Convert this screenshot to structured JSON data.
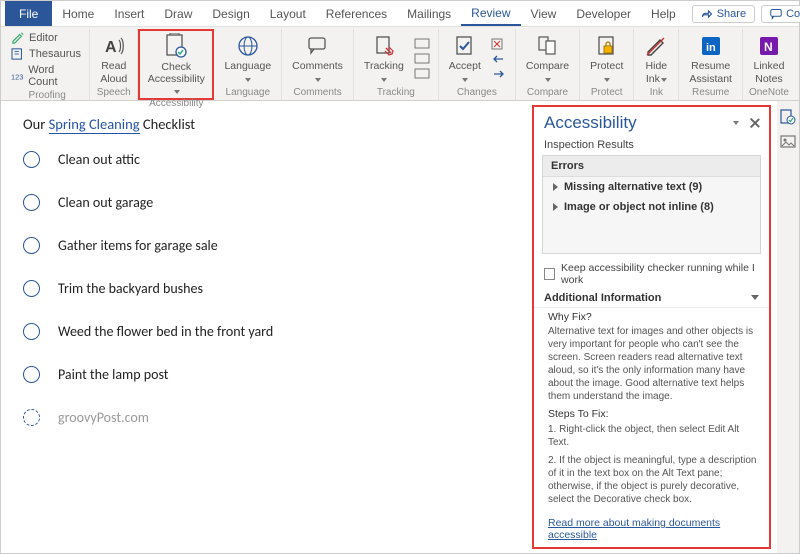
{
  "menubar": {
    "file": "File",
    "tabs": [
      "Home",
      "Insert",
      "Draw",
      "Design",
      "Layout",
      "References",
      "Mailings",
      "Review",
      "View",
      "Developer",
      "Help"
    ],
    "active_tab_index": 7,
    "share": "Share",
    "comments": "Comments"
  },
  "ribbon": {
    "proofing": {
      "items": [
        "Editor",
        "Thesaurus",
        "Word Count"
      ],
      "label": "Proofing"
    },
    "speech": {
      "button": "Read\nAloud",
      "label": "Speech"
    },
    "accessibility": {
      "button": "Check\nAccessibility",
      "label": "Accessibility"
    },
    "language": {
      "button": "Language",
      "label": "Language"
    },
    "comments": {
      "button": "Comments",
      "label": "Comments"
    },
    "tracking": {
      "button": "Tracking",
      "label": "Tracking"
    },
    "accept": {
      "button": "Accept",
      "label": "Changes"
    },
    "compare": {
      "button": "Compare",
      "label": "Compare"
    },
    "protect": {
      "button": "Protect",
      "label": "Protect"
    },
    "ink": {
      "button": "Hide\nInk",
      "label": "Ink"
    },
    "resume": {
      "button": "Resume\nAssistant",
      "label": "Resume"
    },
    "onenote": {
      "button": "Linked\nNotes",
      "label": "OneNote"
    }
  },
  "document": {
    "title_pre": "Our ",
    "title_link": "Spring Cleaning",
    "title_post": " Checklist",
    "items": [
      "Clean out attic",
      "Clean out garage",
      "Gather items for garage sale",
      "Trim the backyard bushes",
      "Weed the flower bed in the front yard",
      "Paint the lamp post"
    ],
    "watermark": "groovyPost.com"
  },
  "pane": {
    "title": "Accessibility",
    "subtitle": "Inspection Results",
    "errors_header": "Errors",
    "errors": [
      "Missing alternative text (9)",
      "Image or object not inline (8)"
    ],
    "checkbox_label": "Keep accessibility checker running while I work",
    "addinfo_header": "Additional Information",
    "why_fix_h": "Why Fix?",
    "why_fix_body": "Alternative text for images and other objects is very important for people who can't see the screen. Screen readers read alternative text aloud, so it's the only information many have about the image. Good alternative text helps them understand the image.",
    "steps_h": "Steps To Fix:",
    "step1": "1. Right-click the object, then select Edit Alt Text.",
    "step2": "2. If the object is meaningful, type a description of it in the text box on the Alt Text pane; otherwise, if the object is purely decorative, select the Decorative check box.",
    "readmore": "Read more about making documents accessible"
  }
}
